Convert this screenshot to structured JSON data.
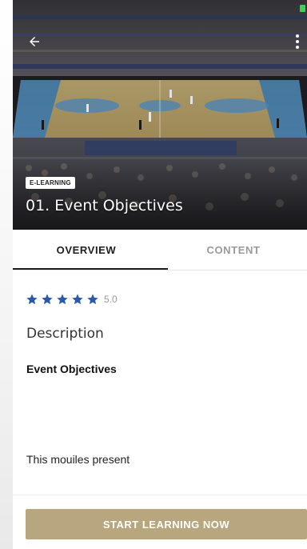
{
  "hero": {
    "badge": "E-LEARNING",
    "title": "01. Event Objectives",
    "image": "basketball-arena-photo"
  },
  "icons": {
    "back": "arrow-left-icon",
    "menu": "more-vert-icon",
    "star": "star-icon"
  },
  "tabs": [
    {
      "label": "OVERVIEW",
      "active": true
    },
    {
      "label": "CONTENT",
      "active": false
    }
  ],
  "rating": {
    "stars": 5,
    "value": "5.0"
  },
  "description": {
    "heading": "Description",
    "subtitle": "Event Objectives",
    "body": "This mouiles present"
  },
  "cta": {
    "label": "START LEARNING NOW"
  },
  "colors": {
    "star": "#2b5aa8",
    "cta": "#b7a67e",
    "active_tab": "#1e1e1e",
    "inactive_tab": "#9a9a9a",
    "status_indicator": "#39d353"
  }
}
